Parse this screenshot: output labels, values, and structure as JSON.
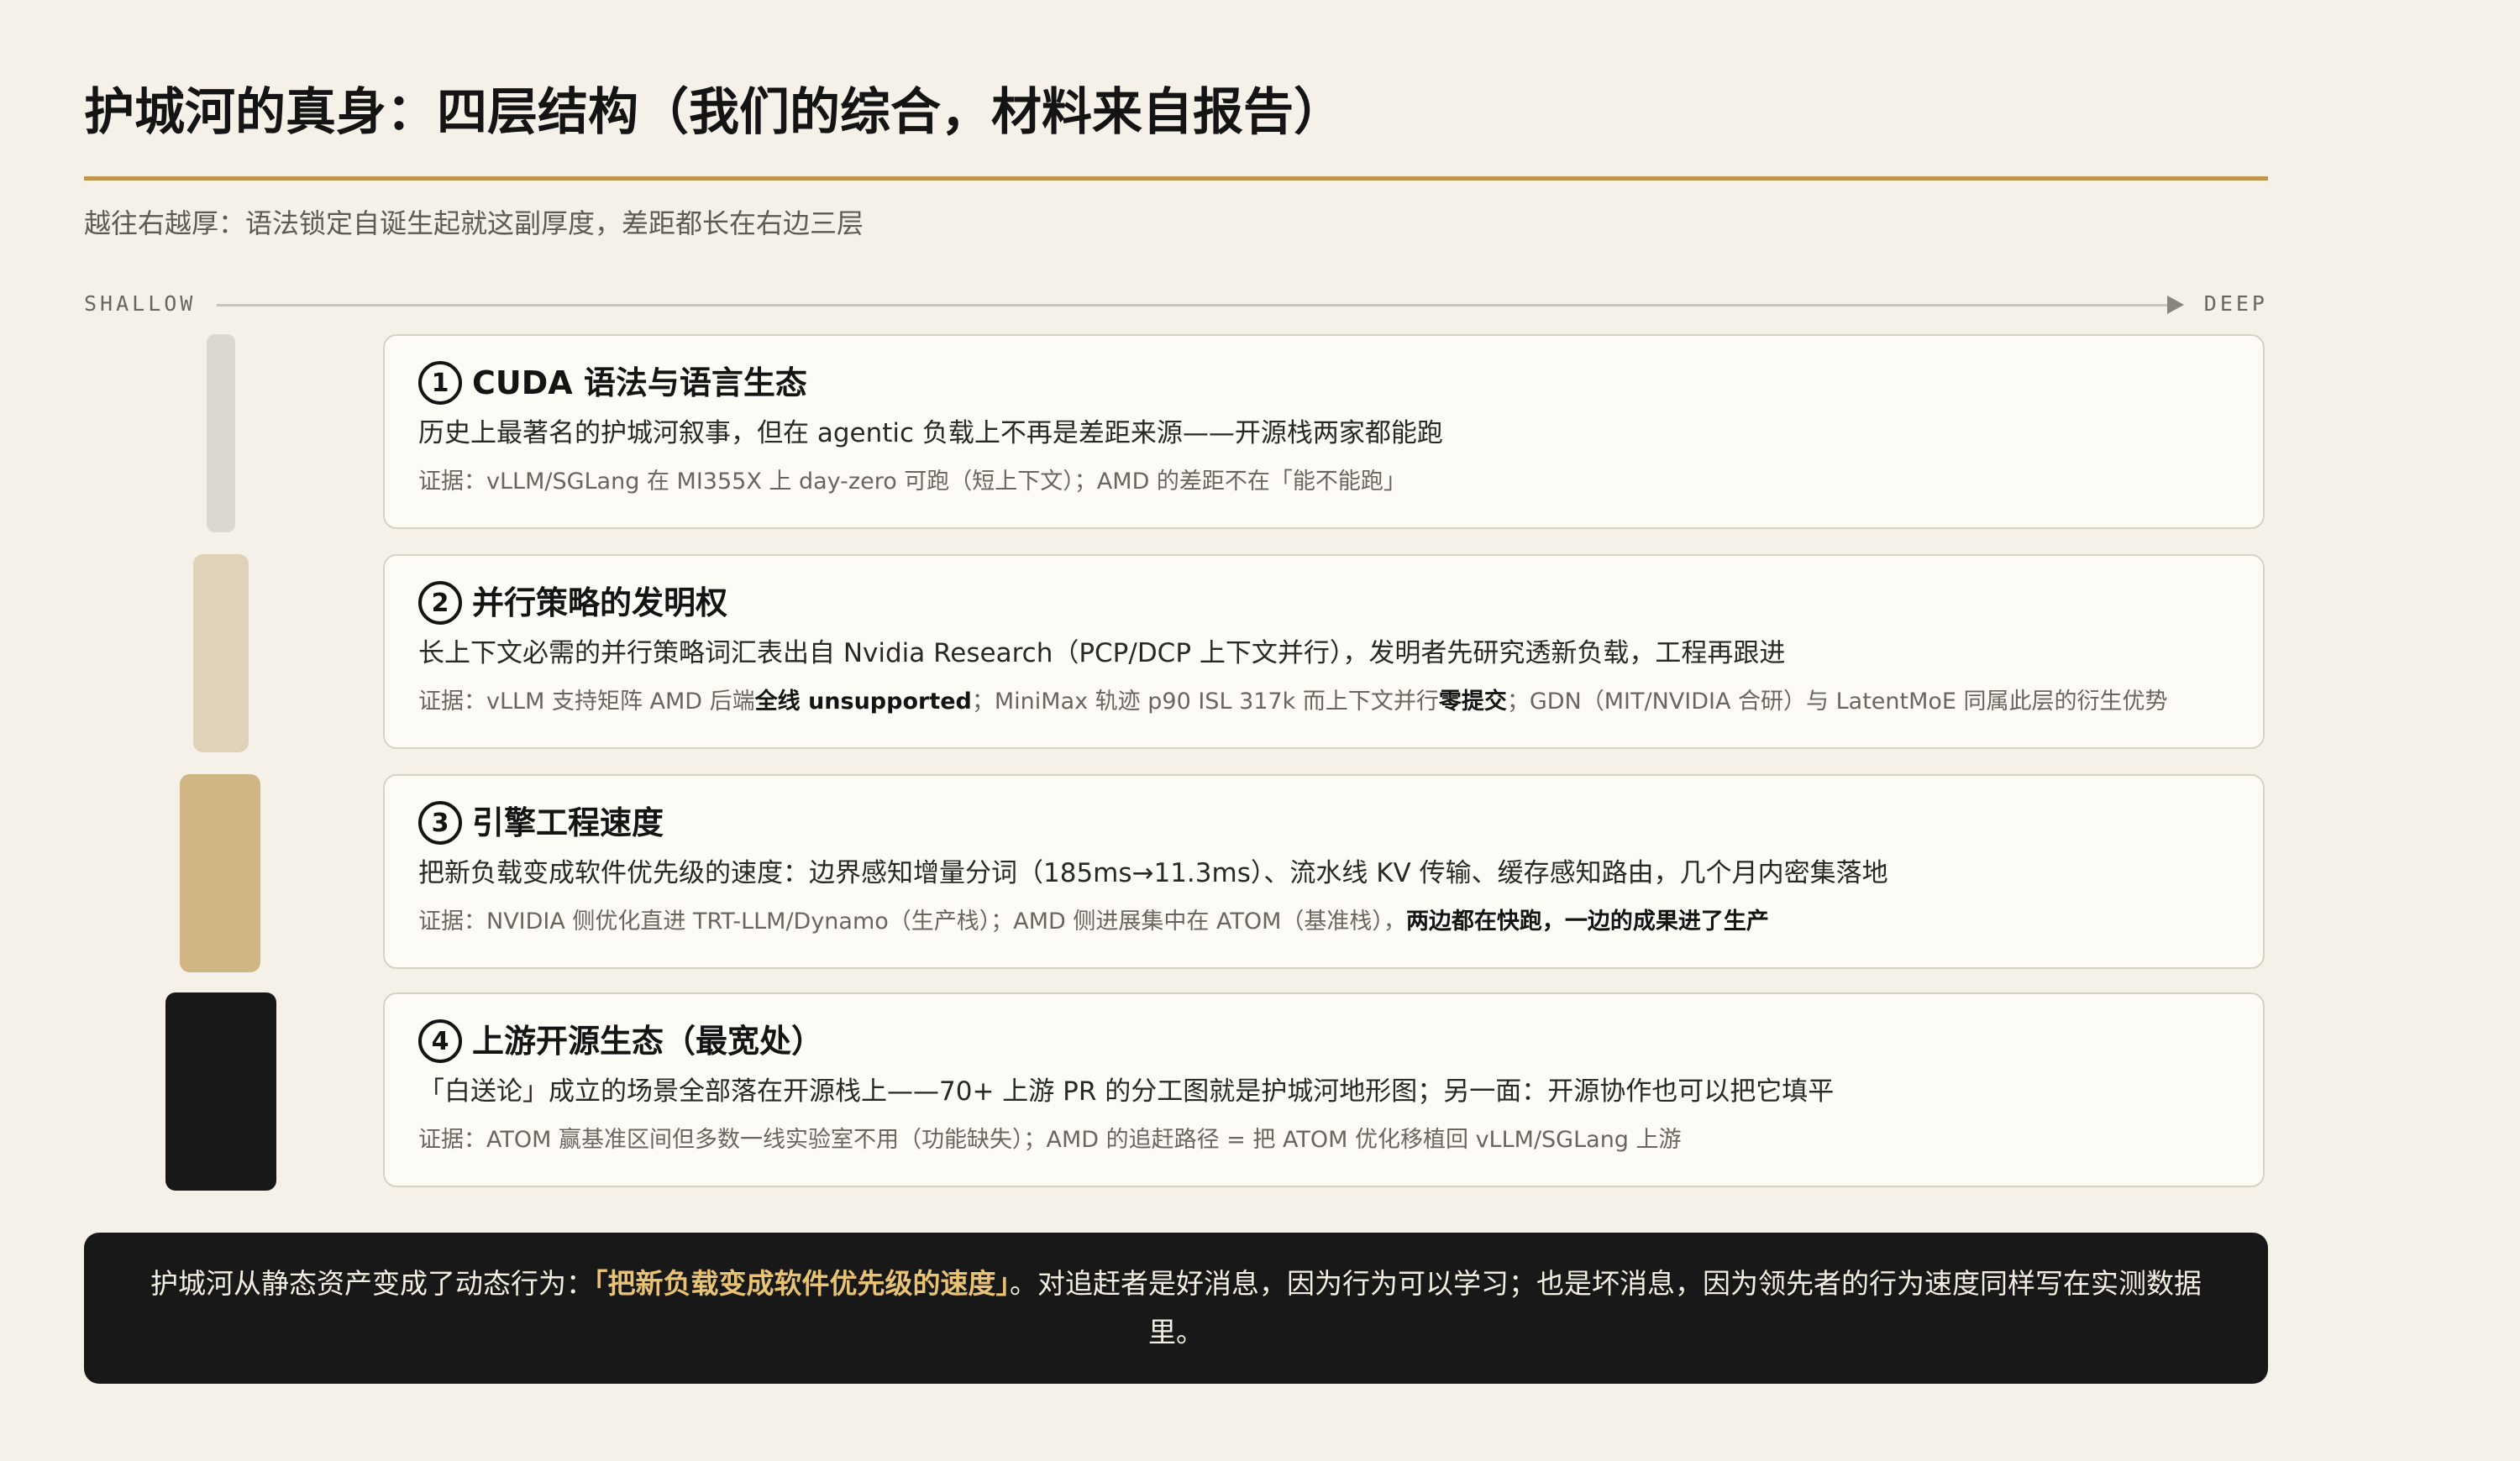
{
  "header": {
    "title": "护城河的真身：四层结构（我们的综合，材料来自报告）",
    "subtitle": "越往右越厚：语法锁定自诞生起就这副厚度，差距都长在右边三层"
  },
  "axis": {
    "start_label": "SHALLOW",
    "end_label": "DEEP"
  },
  "colors": {
    "accent_rule": "#c0954e",
    "bar_1": "#dcd8d1",
    "bar_2": "#e0d2b8",
    "bar_3": "#d1b685",
    "bar_4": "#181818",
    "callout_bg": "#181818",
    "callout_highlight": "#e8c275"
  },
  "layers": [
    {
      "num": "1",
      "title": "CUDA 语法与语言生态",
      "desc": "历史上最著名的护城河叙事，但在 agentic 负载上不再是差距来源——开源栈两家都能跑",
      "evidence": {
        "t1": "证据：vLLM/SGLang 在 MI355X 上 day-zero 可跑（短上下文）；AMD 的差距不在「能不能跑」"
      }
    },
    {
      "num": "2",
      "title": "并行策略的发明权",
      "desc": "长上下文必需的并行策略词汇表出自 Nvidia Research（PCP/DCP 上下文并行），发明者先研究透新负载，工程再跟进",
      "evidence": {
        "t1": "证据：vLLM 支持矩阵 AMD 后端",
        "b1": "全线 unsupported",
        "t2": "；MiniMax 轨迹 p90 ISL 317k 而上下文并行",
        "b2": "零提交",
        "t3": "；GDN（MIT/NVIDIA 合研）与 LatentMoE 同属此层的衍生优势"
      }
    },
    {
      "num": "3",
      "title": "引擎工程速度",
      "desc": "把新负载变成软件优先级的速度：边界感知增量分词（185ms→11.3ms）、流水线 KV 传输、缓存感知路由，几个月内密集落地",
      "evidence": {
        "t1": "证据：NVIDIA 侧优化直进 TRT-LLM/Dynamo（生产栈）；AMD 侧进展集中在 ATOM（基准栈），",
        "b1": "两边都在快跑，一边的成果进了生产"
      }
    },
    {
      "num": "4",
      "title": "上游开源生态（最宽处）",
      "desc": "「白送论」成立的场景全部落在开源栈上——70+ 上游 PR 的分工图就是护城河地形图；另一面：开源协作也可以把它填平",
      "evidence": {
        "t1": "证据：ATOM 赢基准区间但多数一线实验室不用（功能缺失）；AMD 的追赶路径 = 把 ATOM 优化移植回 vLLM/SGLang 上游"
      }
    }
  ],
  "callout": {
    "before": "护城河从静态资产变成了动态行为：",
    "highlight": "「把新负载变成软件优先级的速度」",
    "after": "。对追赶者是好消息，因为行为可以学习；也是坏消息，因为领先者的行为速度同样写在实测数据里。"
  }
}
